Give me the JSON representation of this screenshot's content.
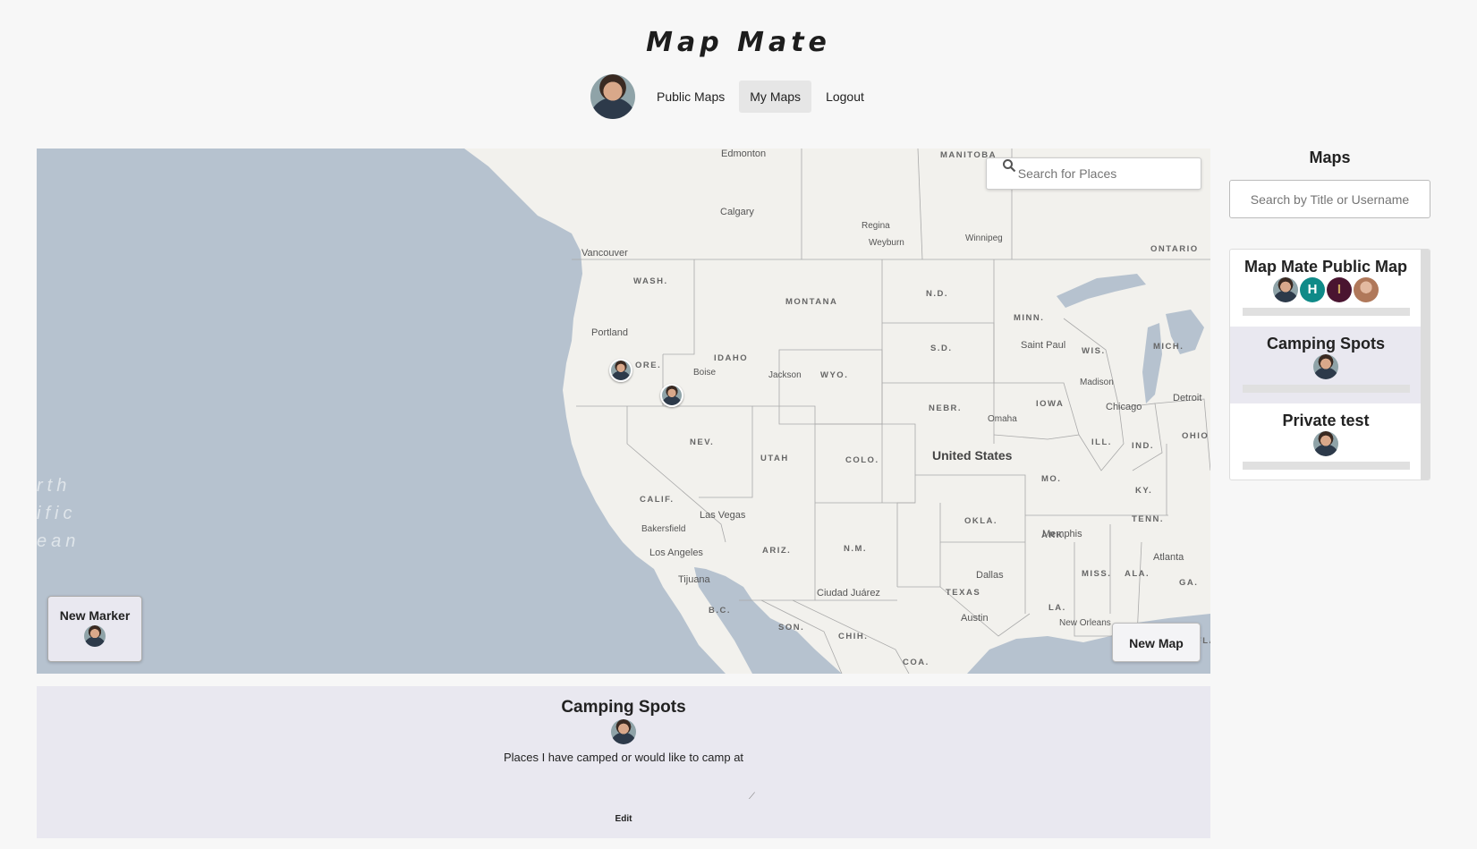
{
  "app": {
    "title": "Map Mate"
  },
  "nav": {
    "items": [
      {
        "label": "Public Maps",
        "active": false
      },
      {
        "label": "My Maps",
        "active": true
      },
      {
        "label": "Logout",
        "active": false
      }
    ]
  },
  "map": {
    "search_placeholder": "Search for Places",
    "new_marker_label": "New Marker",
    "new_map_label": "New Map",
    "country_label": "United States",
    "ocean_label": [
      "rth",
      "ific",
      "ean"
    ],
    "cities": [
      "Edmonton",
      "Calgary",
      "Regina",
      "Weyburn",
      "Winnipeg",
      "Vancouver",
      "Portland",
      "Boise",
      "Jackson",
      "Saint Paul",
      "Madison",
      "Chicago",
      "Detroit",
      "Omaha",
      "Las Vegas",
      "Bakersfield",
      "Los Angeles",
      "Tijuana",
      "Ciudad Juárez",
      "Dallas",
      "Austin",
      "Memphis",
      "Atlanta",
      "New Orleans"
    ],
    "states": [
      "MANITOBA",
      "ONTARIO",
      "WASH.",
      "MONTANA",
      "N.D.",
      "MINN.",
      "ORE.",
      "IDAHO",
      "WYO.",
      "S.D.",
      "WIS.",
      "MICH.",
      "NEBR.",
      "IOWA",
      "NEV.",
      "UTAH",
      "COLO.",
      "ILL.",
      "IND.",
      "OHIO",
      "CALIF.",
      "MO.",
      "KY.",
      "OKLA.",
      "ARK.",
      "TENN.",
      "ARIZ.",
      "N.M.",
      "MISS.",
      "ALA.",
      "GA.",
      "TEXAS",
      "LA.",
      "B.C.",
      "SON.",
      "CHIH.",
      "COA.",
      "FLA"
    ],
    "colors": {
      "water": "#b6c2cf",
      "land": "#f2f1ed",
      "border": "#a9a9a9"
    }
  },
  "sidebar": {
    "title": "Maps",
    "search_placeholder": "Search by Title or Username",
    "maps": [
      {
        "title": "Map Mate Public Map",
        "active": false,
        "members": [
          "avatar",
          "H",
          "I",
          "avatar"
        ]
      },
      {
        "title": "Camping Spots",
        "active": true,
        "members": [
          "avatar"
        ]
      },
      {
        "title": "Private test",
        "active": false,
        "members": [
          "avatar"
        ]
      }
    ]
  },
  "details": {
    "title": "Camping Spots",
    "description": "Places I have camped or would like to camp at",
    "edit_label": "Edit"
  }
}
